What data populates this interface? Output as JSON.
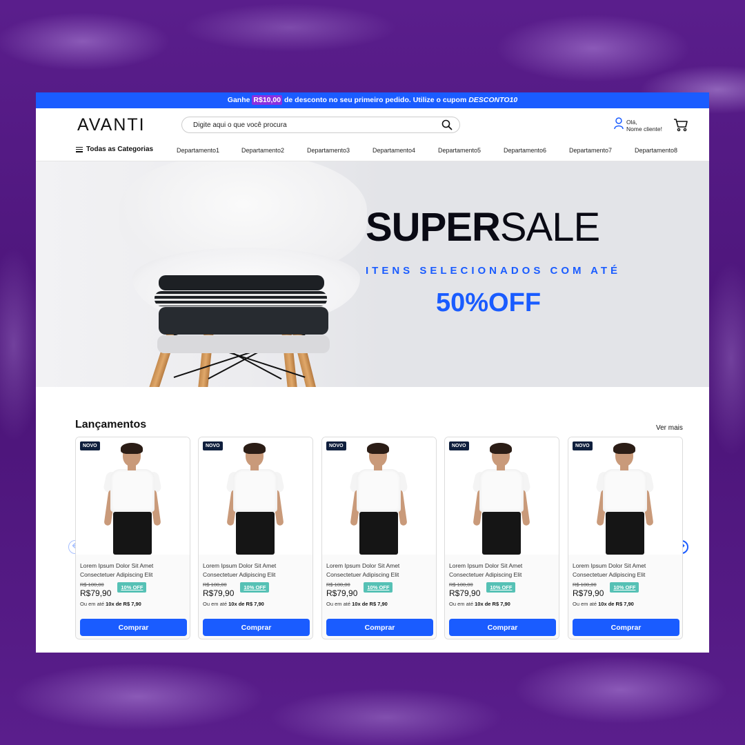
{
  "promo": {
    "prefix": "Ganhe",
    "amount": "R$10,00",
    "middle": "de desconto no seu primeiro pedido. Utilize o cupom",
    "coupon": "DESCONTO10"
  },
  "header": {
    "logo": "AVANTI",
    "search_placeholder": "Digite aqui o que você procura",
    "user_greeting": "Olá,",
    "user_name": "Nome cliente!"
  },
  "nav": {
    "all_categories": "Todas as Categorias",
    "departments": [
      "Departamento1",
      "Departamento2",
      "Departamento3",
      "Departamento4",
      "Departamento5",
      "Departamento6",
      "Departamento7",
      "Departamento8"
    ]
  },
  "hero": {
    "title_bold": "SUPER",
    "title_thin": "SALE",
    "subtitle": "ITENS SELECIONADOS COM ATÉ",
    "discount": "50%OFF"
  },
  "section": {
    "title": "Lançamentos",
    "see_more": "Ver mais"
  },
  "products": [
    {
      "badge": "NOVO",
      "name": "Lorem Ipsum Dolor Sit Amet Consectetuer Adipiscing Elit",
      "old_price": "R$ 100,00",
      "price": "R$79,90",
      "discount": "10% OFF",
      "installments_prefix": "Ou em até",
      "installments": "10x de R$ 7,90",
      "buy": "Comprar"
    },
    {
      "badge": "NOVO",
      "name": "Lorem Ipsum Dolor Sit Amet Consectetuer Adipiscing Elit",
      "old_price": "R$ 100,00",
      "price": "R$79,90",
      "discount": "10% OFF",
      "installments_prefix": "Ou em até",
      "installments": "10x de R$ 7,90",
      "buy": "Comprar"
    },
    {
      "badge": "NOVO",
      "name": "Lorem Ipsum Dolor Sit Amet Consectetuer Adipiscing Elit",
      "old_price": "R$ 100,00",
      "price": "R$79,90",
      "discount": "10% OFF",
      "installments_prefix": "Ou em até",
      "installments": "10x de R$ 7,90",
      "buy": "Comprar"
    },
    {
      "badge": "NOVO",
      "name": "Lorem Ipsum Dolor Sit Amet Consectetuer Adipiscing Elit",
      "old_price": "R$ 100,00",
      "price": "R$79,90",
      "discount": "10% OFF",
      "installments_prefix": "Ou em até",
      "installments": "10x de R$ 7,90",
      "buy": "Comprar"
    },
    {
      "badge": "NOVO",
      "name": "Lorem Ipsum Dolor Sit Amet Consectetuer Adipiscing Elit",
      "old_price": "R$ 100,00",
      "price": "R$79,90",
      "discount": "10% OFF",
      "installments_prefix": "Ou em até",
      "installments": "10x de R$ 7,90",
      "buy": "Comprar"
    }
  ],
  "icons": {
    "search": "search-icon",
    "user": "user-icon",
    "cart": "cart-icon",
    "menu": "hamburger-icon",
    "prev": "arrow-left-icon",
    "next": "arrow-right-icon"
  },
  "colors": {
    "brand_blue": "#1a5cff",
    "promo_highlight": "#8a2fe0",
    "discount_badge": "#56c1b5",
    "new_badge": "#0f1f3d",
    "background_purple": "#4b1478"
  }
}
